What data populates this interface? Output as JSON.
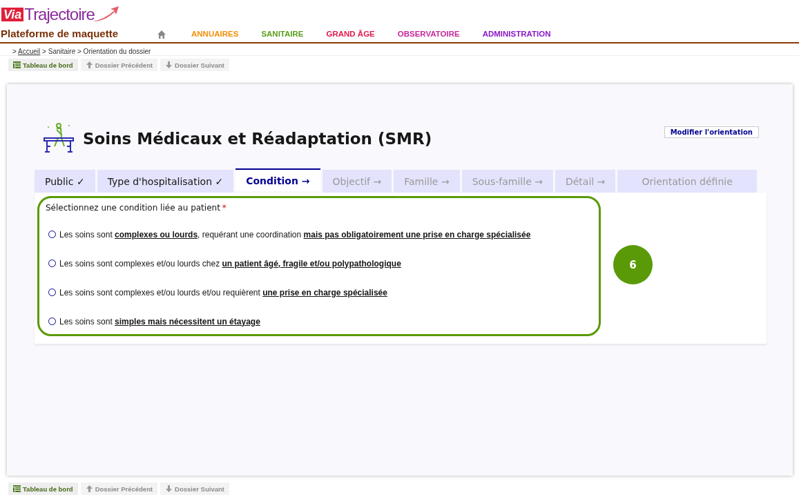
{
  "logo": {
    "prefix": "Via",
    "name": "Trajectoire"
  },
  "platform": "Plateforme de maquette",
  "nav": [
    {
      "label": "ANNUAIRES",
      "color": "#f0900a"
    },
    {
      "label": "SANITAIRE",
      "color": "#5a9e1a"
    },
    {
      "label": "GRAND ÂGE",
      "color": "#e0184a"
    },
    {
      "label": "OBSERVATOIRE",
      "color": "#c8289a"
    },
    {
      "label": "ADMINISTRATION",
      "color": "#8a18c8"
    }
  ],
  "breadcrumb": {
    "separator": ">",
    "items": [
      {
        "label": "Accueil",
        "link": true
      },
      {
        "label": "Sanitaire",
        "link": false
      },
      {
        "label": "Orientation du dossier",
        "link": false
      }
    ]
  },
  "toolbar_top": [
    {
      "kind": "dashboard",
      "label": "Tableau de bord",
      "disabled": false
    },
    {
      "kind": "up",
      "label": "Dossier Précédent",
      "disabled": true
    },
    {
      "kind": "down",
      "label": "Dossier Suivant",
      "disabled": true
    }
  ],
  "page_title": "Soins Médicaux et Réadaptation (SMR)",
  "modify_button": "Modifier l'orientation",
  "tabs": [
    {
      "label": "Public ✓",
      "selected": false,
      "disabled": false
    },
    {
      "label": "Type d'hospitalisation ✓",
      "selected": false,
      "disabled": false
    },
    {
      "label": "Condition →",
      "selected": true,
      "disabled": false
    },
    {
      "label": "Objectif →",
      "selected": false,
      "disabled": true
    },
    {
      "label": "Famille →",
      "selected": false,
      "disabled": true
    },
    {
      "label": "Sous-famille →",
      "selected": false,
      "disabled": true
    },
    {
      "label": "Détail →",
      "selected": false,
      "disabled": true
    },
    {
      "label": "Orientation définie",
      "selected": false,
      "disabled": true
    }
  ],
  "question": {
    "label": "Sélectionnez une condition liée au patient",
    "required_mark": "*"
  },
  "options": [
    {
      "text": "Les soins sont **complexes ou lourds**, requérant une coordination **mais pas obligatoirement une prise en charge spécialisée**",
      "selected": false
    },
    {
      "text": "Les soins sont complexes et/ou lourds chez **un patient âgé, fragile et/ou polypathologique**",
      "selected": false
    },
    {
      "text": "Les soins sont complexes et/ou lourds et/ou requièrent **une prise en charge spécialisée**",
      "selected": false
    },
    {
      "text": "Les soins sont **simples mais nécessitent un étayage**",
      "selected": false
    }
  ],
  "annotation": {
    "label": "6",
    "color": "#5a9a08"
  },
  "toolbar_bottom": [
    {
      "kind": "dashboard",
      "label": "Tableau de bord",
      "disabled": false
    },
    {
      "kind": "up",
      "label": "Dossier Précédent",
      "disabled": true
    },
    {
      "kind": "down",
      "label": "Dossier Suivant",
      "disabled": true
    }
  ]
}
